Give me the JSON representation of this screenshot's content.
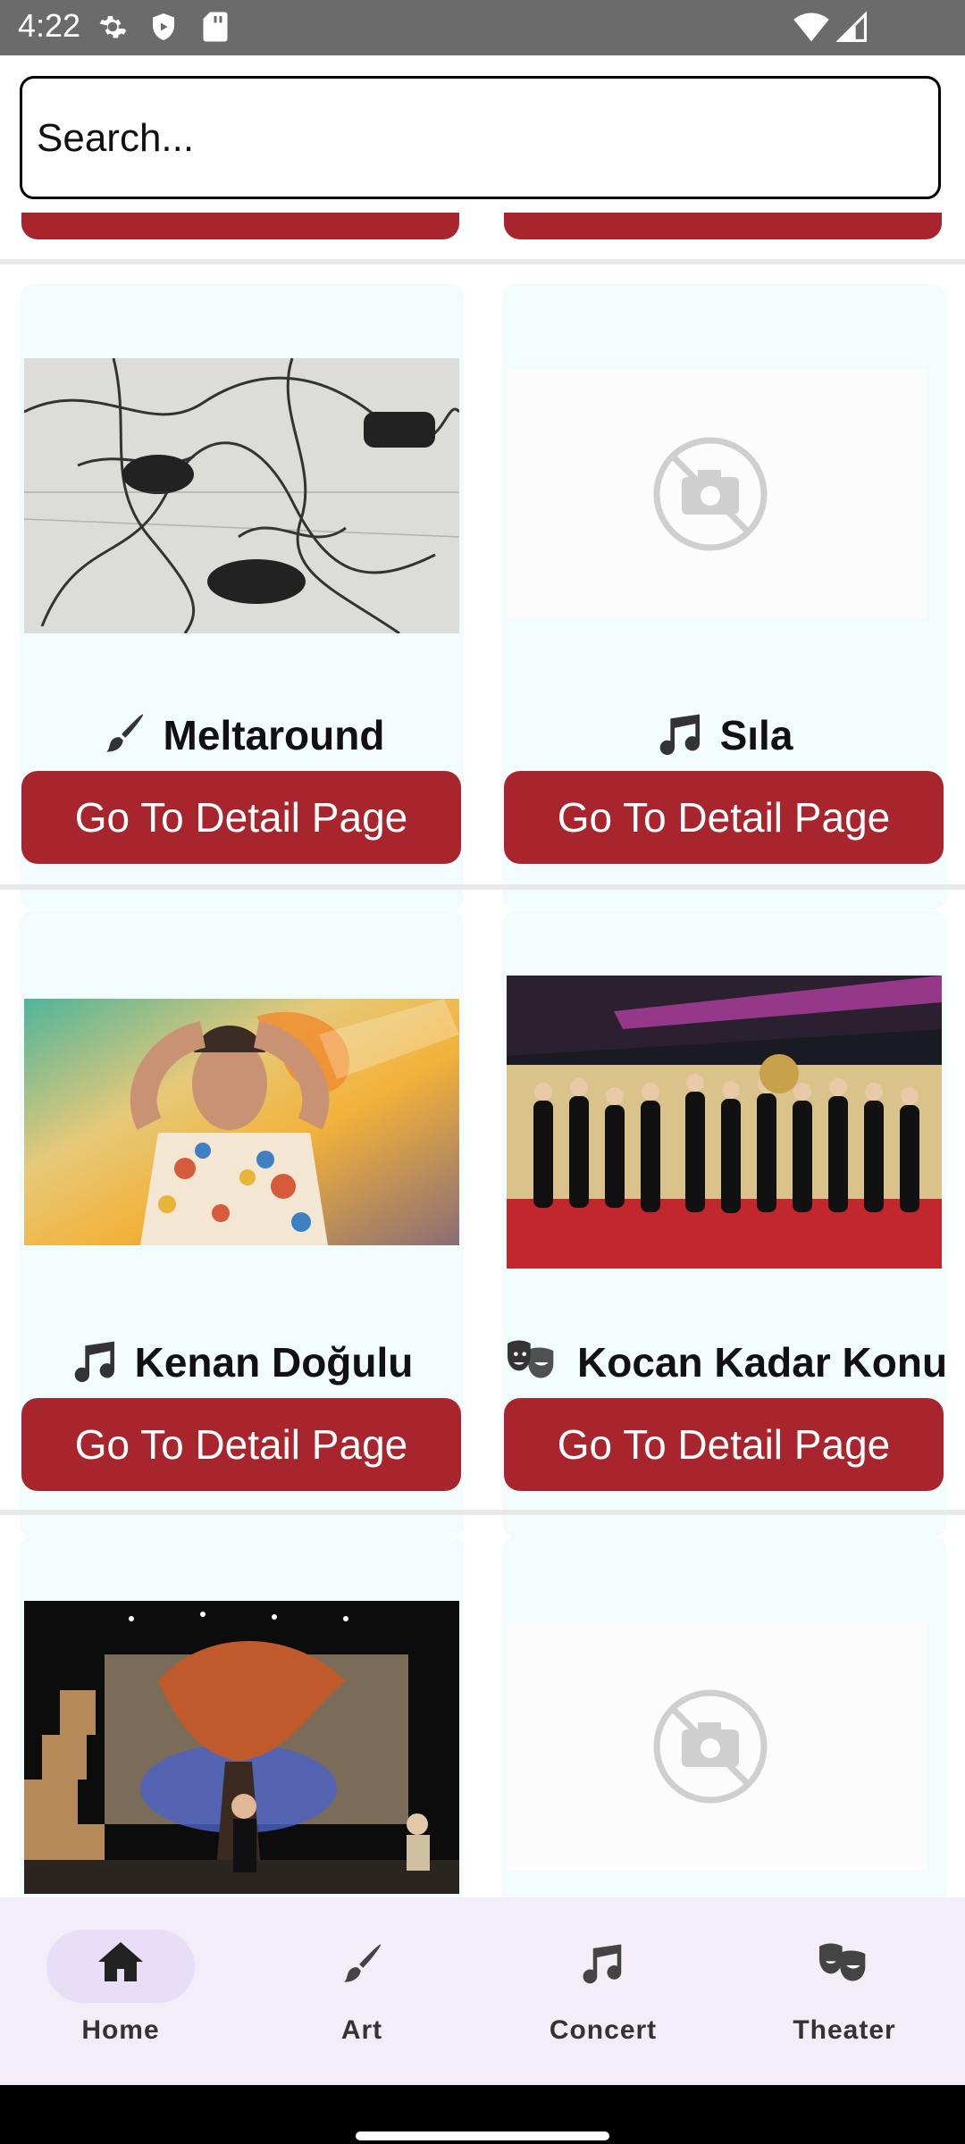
{
  "status_bar": {
    "time": "4:22"
  },
  "search": {
    "placeholder": "Search..."
  },
  "cards": [
    {
      "title": "Meltaround",
      "category_icon": "brush-icon",
      "button": "Go To Detail Page",
      "image": "artwork-sketch"
    },
    {
      "title": "Sıla",
      "category_icon": "music-note-icon",
      "button": "Go To Detail Page",
      "image": "no-photo-placeholder"
    },
    {
      "title": "Kenan Doğulu",
      "category_icon": "music-note-icon",
      "button": "Go To Detail Page",
      "image": "artist-photo"
    },
    {
      "title": "Kocan Kadar Konuş",
      "category_icon": "theater-masks-icon",
      "button": "Go To Detail Page",
      "image": "red-carpet-photo"
    },
    {
      "title": "",
      "category_icon": "",
      "button": "",
      "image": "stage-photo"
    },
    {
      "title": "",
      "category_icon": "",
      "button": "",
      "image": "no-photo-placeholder"
    }
  ],
  "bottom_nav": {
    "items": [
      {
        "label": "Home",
        "icon": "home-icon",
        "active": true
      },
      {
        "label": "Art",
        "icon": "brush-icon",
        "active": false
      },
      {
        "label": "Concert",
        "icon": "music-note-icon",
        "active": false
      },
      {
        "label": "Theater",
        "icon": "theater-masks-icon",
        "active": false
      }
    ]
  },
  "colors": {
    "button": "#a8252d",
    "card_bg": "#f2fcfd",
    "nav_bg": "#f3edf7",
    "nav_active_pill": "#e8def8",
    "status_bar": "#6b6b6b"
  }
}
